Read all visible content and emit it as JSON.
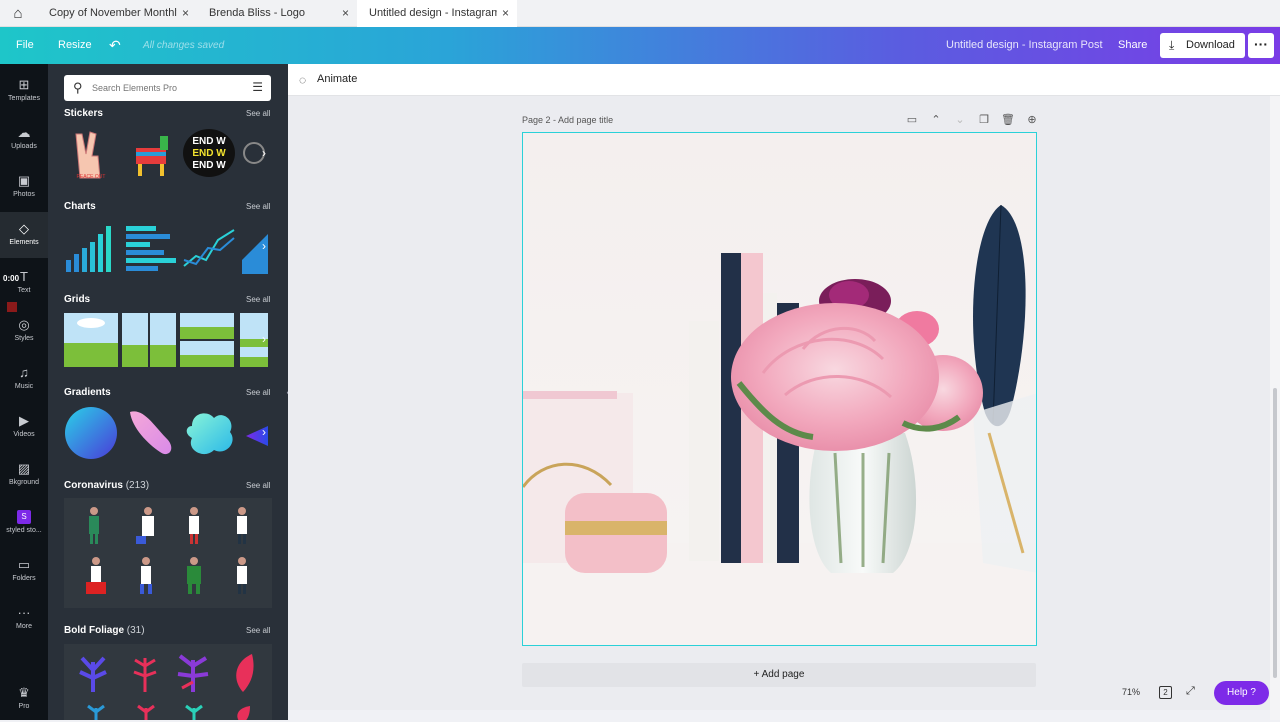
{
  "tabs": [
    {
      "label": "Copy of November Monthly Planner",
      "close": "×"
    },
    {
      "label": "Brenda Bliss - Logo",
      "close": "×"
    },
    {
      "label": "Untitled design - Instagram Post",
      "close": "×"
    }
  ],
  "toolbar": {
    "file": "File",
    "resize": "Resize",
    "undo": "↶",
    "saved": "All changes saved",
    "doc_title": "Untitled design - Instagram Post",
    "share": "Share",
    "download": "Download",
    "more": "···"
  },
  "rail": [
    {
      "label": "Templates",
      "icon": "⊞"
    },
    {
      "label": "Uploads",
      "icon": "☁"
    },
    {
      "label": "Photos",
      "icon": "▣"
    },
    {
      "label": "Elements",
      "icon": "◇"
    },
    {
      "label": "Text",
      "icon": "T"
    },
    {
      "label": "Styles",
      "icon": "◎"
    },
    {
      "label": "Music",
      "icon": "♫"
    },
    {
      "label": "Videos",
      "icon": "▶"
    },
    {
      "label": "Bkground",
      "icon": "▨"
    },
    {
      "label": "styled sto...",
      "icon": "S"
    },
    {
      "label": "Folders",
      "icon": "▭"
    },
    {
      "label": "More",
      "icon": "···"
    },
    {
      "label": "Pro",
      "icon": "♛"
    }
  ],
  "timer": "0:00",
  "search": {
    "placeholder": "Search Elements Pro"
  },
  "sections": {
    "stickers": {
      "title": "Stickers",
      "see_all": "See all"
    },
    "charts": {
      "title": "Charts",
      "see_all": "See all"
    },
    "grids": {
      "title": "Grids",
      "see_all": "See all"
    },
    "gradients": {
      "title": "Gradients",
      "see_all": "See all"
    },
    "coronavirus": {
      "title": "Coronavirus",
      "count": "(213)",
      "see_all": "See all"
    },
    "bold_foliage": {
      "title": "Bold Foliage",
      "count": "(31)",
      "see_all": "See all"
    }
  },
  "animate": {
    "label": "Animate"
  },
  "page": {
    "label": "Page 2 - Add page title"
  },
  "add_page": "+ Add page",
  "footer": {
    "zoom": "71%",
    "page_count": "2",
    "help": "Help ?"
  },
  "colors": {
    "accent": "#7d2ae8",
    "selection": "#2ad1d8",
    "panel": "#293039"
  }
}
